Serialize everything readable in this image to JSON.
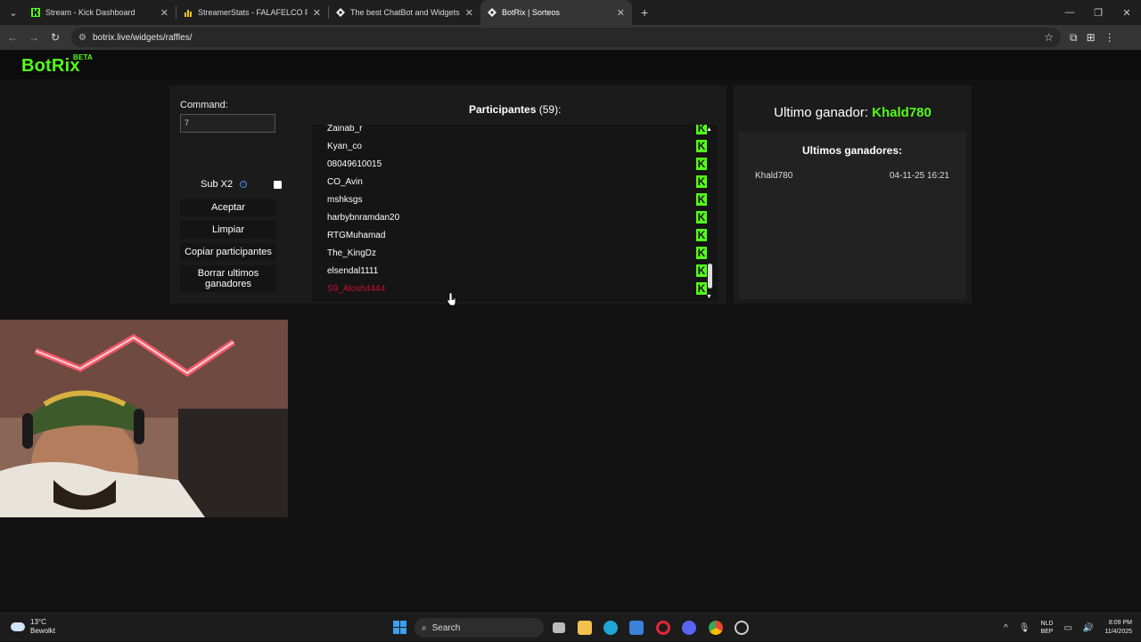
{
  "browser": {
    "tabs": [
      {
        "title": "Stream - Kick Dashboard",
        "active": false
      },
      {
        "title": "StreamerStats - FALAFELCO Pro",
        "active": false
      },
      {
        "title": "The best ChatBot and Widgets",
        "active": false
      },
      {
        "title": "BotRix | Sorteos",
        "active": true
      }
    ],
    "url": "botrix.live/widgets/raffles/"
  },
  "app": {
    "logo": "BotRix",
    "logo_badge": "BETA"
  },
  "controls": {
    "command_label": "Command:",
    "command_value": "7",
    "sub_label": "Sub X2",
    "accept_label": "Aceptar",
    "clear_label": "Limpiar",
    "copy_label": "Copiar participantes",
    "delete_label": "Borrar ultimos ganadores"
  },
  "participants": {
    "title": "Participantes",
    "count": "(59)",
    "suffix": ":",
    "rows": [
      {
        "name": "Zainab_r",
        "highlight": false
      },
      {
        "name": "Kyan_co",
        "highlight": false
      },
      {
        "name": "08049610015",
        "highlight": false
      },
      {
        "name": "CO_Avin",
        "highlight": false
      },
      {
        "name": "mshksgs",
        "highlight": false
      },
      {
        "name": "harbybnramdan20",
        "highlight": false
      },
      {
        "name": "RTGMuhamad",
        "highlight": false
      },
      {
        "name": "The_KingDz",
        "highlight": false
      },
      {
        "name": "elsendal1111",
        "highlight": false
      },
      {
        "name": "S9_Alosh4444",
        "highlight": true
      }
    ],
    "platform_icon": "kick-icon"
  },
  "winners": {
    "last_label": "Ultimo ganador:",
    "last_name": "Khald780",
    "list_title": "Ultimos ganadores:",
    "list": [
      {
        "name": "Khald780",
        "date": "04-11-25 16:21"
      }
    ]
  },
  "taskbar": {
    "temp": "13°C",
    "weather": "Bewolkt",
    "search": "Search",
    "lang_top": "NLD",
    "lang_bottom": "BEP",
    "time": "8:09 PM",
    "date": "11/4/2025"
  },
  "colors": {
    "accent": "#53fc18",
    "highlight": "#c8102e"
  }
}
